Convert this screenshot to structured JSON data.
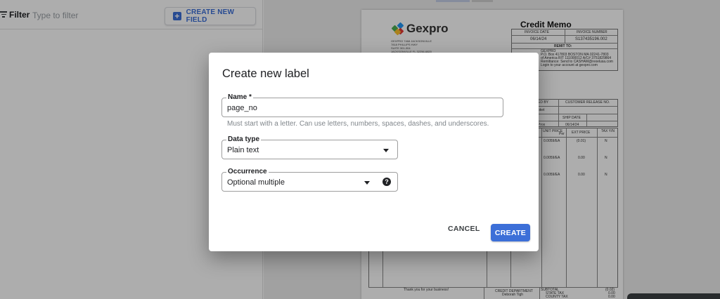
{
  "toolbar": {
    "filter_label": "Filter",
    "filter_placeholder": "Type to filter",
    "create_field_label": "CREATE NEW FIELD"
  },
  "document": {
    "company": "Gexpro",
    "title": "Credit Memo",
    "address_lines": [
      "GEXPRO 7468 JACKSONVILLE",
      "7818 PHILLIPS HWY",
      "SUITE 301-304",
      "JACKSONVILLE FL 32256-6820"
    ],
    "invoice_date_header": "INVOICE DATE",
    "invoice_number_header": "INVOICE NUMBER",
    "invoice_date": "06/14/24",
    "invoice_number": "S137435196.002",
    "remit_to": "REMIT TO:",
    "remit_lines": [
      "GEXPRO",
      "P.O. Box 417803 BOSTON MA 02241-7803",
      "of America RIT 111000012 A/C# 3751829864",
      "Remittance: Send to CASHAM@rexelusa.com",
      "Login to your account at gexpro.com"
    ],
    "cust_release_header": "CUSTOMER RELEASE NO.",
    "ordered_by_header": "ED BY",
    "ship_date_header": "SHIP DATE",
    "ship_date": "06/14/24",
    "order_row_value": "pket",
    "ship_via": "Prox",
    "col_unit_price": "UNIT PRICE",
    "col_per": "Per",
    "col_ext_price": "EXT PRICE",
    "col_tax": "TAX Y/N",
    "rows": [
      {
        "unit": "0.0059/EA",
        "ext": "(0.01)",
        "tax": "N"
      },
      {
        "unit": "0.0059/EA",
        "ext": "0.00",
        "tax": "N"
      },
      {
        "unit": "0.0059/EA",
        "ext": "0.00",
        "tax": "N"
      }
    ],
    "footer_thanks": "Thank you for your business!",
    "credit_department": "CREDIT DEPARTMENT",
    "credit_contact": "Deborah Tigh",
    "subtotal_label": "SUBTOTAL",
    "state_tax_label": "STATE TAX",
    "county_tax_label": "COUNTY TAX",
    "subtotal_value": "(0.02)",
    "state_tax_value": "0.00",
    "county_tax_value": "0.00"
  },
  "dialog": {
    "title": "Create new label",
    "name_label": "Name *",
    "name_value": "page_no",
    "name_hint": "Must start with a letter. Can use letters, numbers, spaces, dashes, and underscores.",
    "data_type_label": "Data type",
    "data_type_value": "Plain text",
    "occurrence_label": "Occurrence",
    "occurrence_value": "Optional multiple",
    "cancel_label": "CANCEL",
    "create_label": "CREATE"
  },
  "colors": {
    "accent": "#3c6fd8",
    "scrim": "rgba(0,0,0,0.32)"
  }
}
